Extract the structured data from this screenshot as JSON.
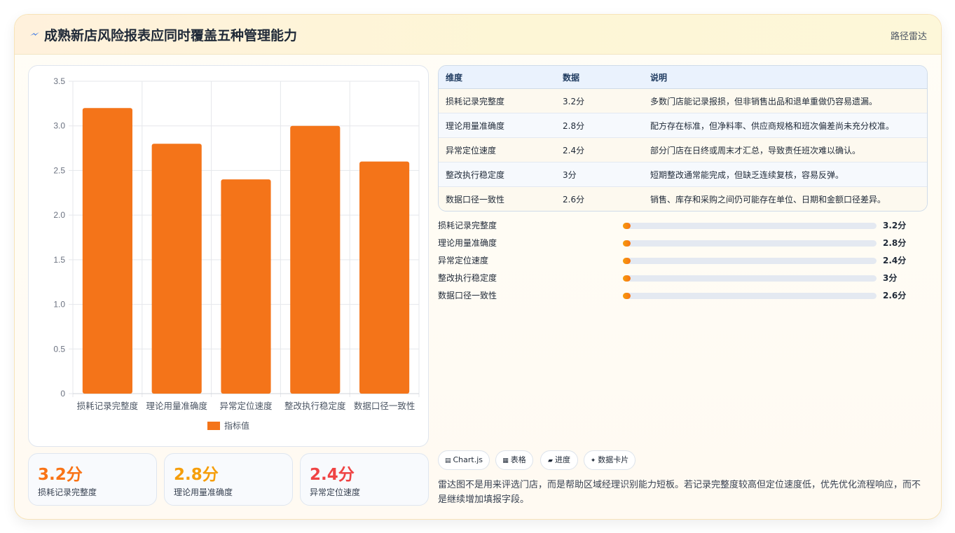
{
  "header": {
    "icon": "lightning-icon",
    "title": "成熟新店风险报表应同时覆盖五种管理能力",
    "tag": "路径雷达"
  },
  "chart_data": {
    "type": "bar",
    "categories": [
      "损耗记录完整度",
      "理论用量准确度",
      "异常定位速度",
      "整改执行稳定度",
      "数据口径一致性"
    ],
    "series": [
      {
        "name": "指标值",
        "values": [
          3.2,
          2.8,
          2.4,
          3,
          2.6
        ],
        "color": "#f47419"
      }
    ],
    "ylim": [
      0,
      3.5
    ],
    "yticks": [
      "0",
      "0.5",
      "1.0",
      "1.5",
      "2.0",
      "2.5",
      "3.0",
      "3.5"
    ],
    "grid": true,
    "legend": "bottom"
  },
  "stats": [
    {
      "value": "3.2分",
      "label": "损耗记录完整度",
      "color": "#f97316"
    },
    {
      "value": "2.8分",
      "label": "理论用量准确度",
      "color": "#f59e0b"
    },
    {
      "value": "2.4分",
      "label": "异常定位速度",
      "color": "#ef4444"
    }
  ],
  "table": {
    "headers": [
      "维度",
      "数据",
      "说明"
    ],
    "rows": [
      [
        "损耗记录完整度",
        "3.2分",
        "多数门店能记录报损，但非销售出品和退单重做仍容易遗漏。"
      ],
      [
        "理论用量准确度",
        "2.8分",
        "配方存在标准，但净料率、供应商规格和班次偏差尚未充分校准。"
      ],
      [
        "异常定位速度",
        "2.4分",
        "部分门店在日终或周末才汇总，导致责任班次难以确认。"
      ],
      [
        "整改执行稳定度",
        "3分",
        "短期整改通常能完成，但缺乏连续复核，容易反弹。"
      ],
      [
        "数据口径一致性",
        "2.6分",
        "销售、库存和采购之间仍可能存在单位、日期和金额口径差异。"
      ]
    ]
  },
  "progress": [
    {
      "label": "损耗记录完整度",
      "value": "3.2分",
      "fill": 0.03
    },
    {
      "label": "理论用量准确度",
      "value": "2.8分",
      "fill": 0.03
    },
    {
      "label": "异常定位速度",
      "value": "2.4分",
      "fill": 0.03
    },
    {
      "label": "整改执行稳定度",
      "value": "3分",
      "fill": 0.03
    },
    {
      "label": "数据口径一致性",
      "value": "2.6分",
      "fill": 0.03
    }
  ],
  "chips": [
    {
      "icon": "chart-icon",
      "glyph": "▤",
      "label": "Chart.js"
    },
    {
      "icon": "table-icon",
      "glyph": "▦",
      "label": "表格"
    },
    {
      "icon": "progress-icon",
      "glyph": "▰",
      "label": "进度"
    },
    {
      "icon": "sparkle-icon",
      "glyph": "✦",
      "label": "数据卡片"
    }
  ],
  "note": "雷达图不是用来评选门店，而是帮助区域经理识别能力短板。若记录完整度较高但定位速度低，优先优化流程响应，而不是继续增加填报字段。"
}
